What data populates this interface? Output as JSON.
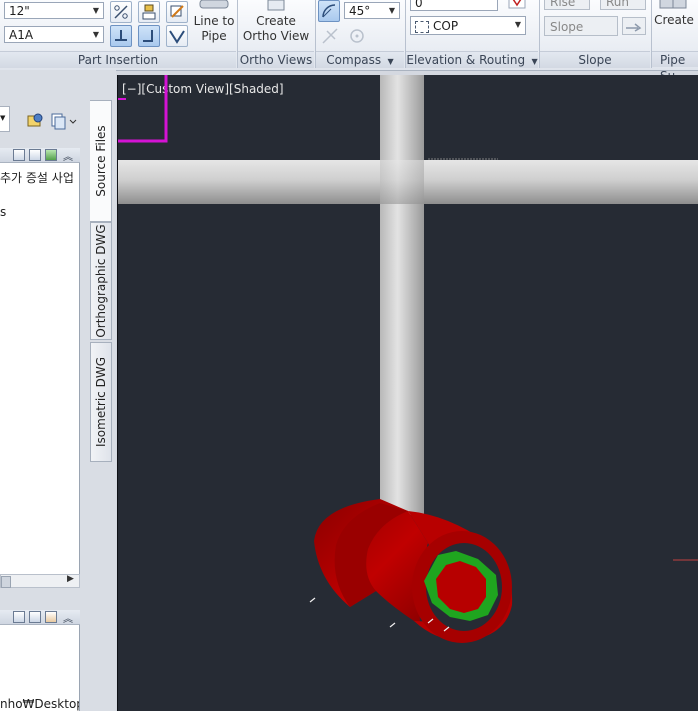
{
  "ribbon": {
    "size_combo": "12\"",
    "spec_combo": "A1A",
    "part_insertion_title": "Part Insertion",
    "line_to_pipe": [
      "Line to",
      "Pipe"
    ],
    "create_ortho": [
      "Create",
      "Ortho View"
    ],
    "ortho_views_title": "Ortho Views",
    "angle_combo": "45°",
    "compass_title": "Compass",
    "elevation_value": "0",
    "cop_combo": "COP",
    "elevation_title": "Elevation & Routing",
    "rise_label": "Rise",
    "run_label": "Run",
    "slope_placeholder": "Slope",
    "slope_title": "Slope",
    "create_label": "Create",
    "pipe_support_title": "Pipe Su"
  },
  "palette": {
    "korean_text": "추가 증설 사업",
    "fragment": "s",
    "tabs": [
      "Source Files",
      "Orthographic DWG",
      "Isometric DWG"
    ],
    "path_text": "nho₩Desktop₩"
  },
  "viewport": {
    "label": "[−][Custom View][Shaded]",
    "pipe_color": "#c8c8c8",
    "red_color": "#b00000",
    "green_color": "#1fa51f",
    "background": "#262b34"
  }
}
